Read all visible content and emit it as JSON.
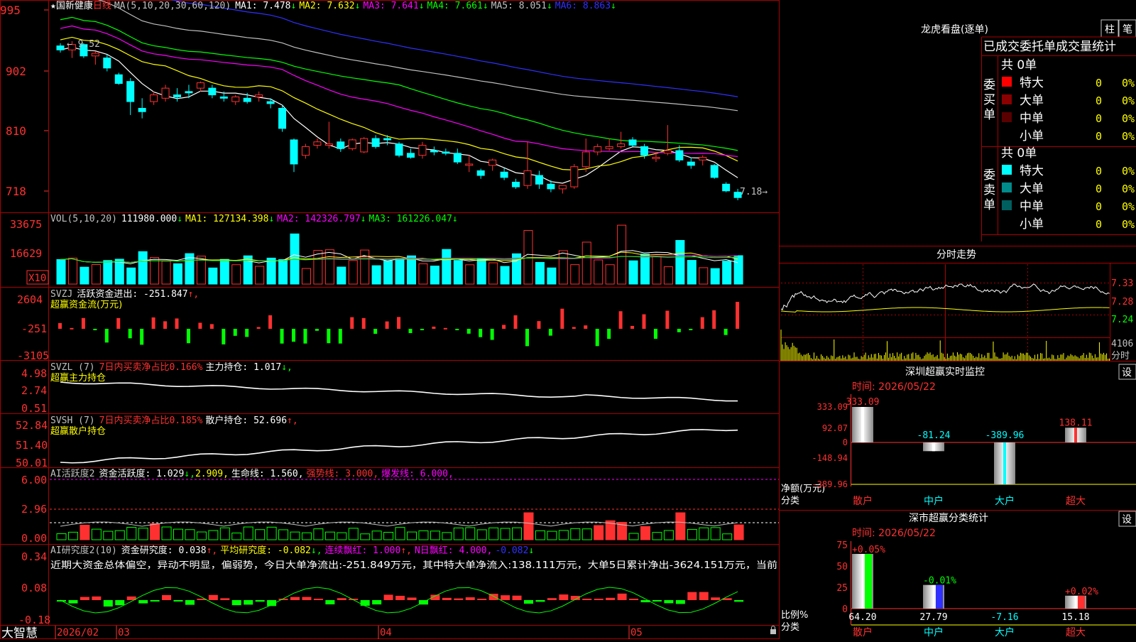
{
  "app": {
    "brand": "大智慧",
    "date_axis": {
      "labels": [
        "2026/02",
        "03",
        "04",
        "05"
      ]
    }
  },
  "colors": {
    "up": "#ff3030",
    "down": "#00ffff",
    "grid": "#aa0000",
    "axis_text": "#ff3030",
    "ma1": "#ffffff",
    "ma2": "#ffff00",
    "ma3": "#ff00ff",
    "ma4": "#00ff00",
    "ma5": "#c0c0c0",
    "ma6": "#3030ff",
    "white_line": "#ffffff",
    "yellow": "#ffff00",
    "magenta": "#ff00ff",
    "green": "#00ff00",
    "cyan": "#00ffff"
  },
  "kline": {
    "stock": "★国新健康",
    "period": "日线",
    "ma_text": "MA(5,10,20,30,60,120)",
    "mas": [
      {
        "label": "MA1: 7.478",
        "arrow": "↓"
      },
      {
        "label": "MA2: 7.632",
        "arrow": "↓"
      },
      {
        "label": "MA3: 7.641",
        "arrow": "↓"
      },
      {
        "label": "MA4: 7.661",
        "arrow": "↓"
      },
      {
        "label": "MA5: 8.051",
        "arrow": "↓"
      },
      {
        "label": "MA6: 8.863",
        "arrow": "↓"
      }
    ],
    "y_ticks": [
      "995",
      "902",
      "810",
      "718"
    ],
    "high_label": "9.52",
    "low_label": "7.18→"
  },
  "volume": {
    "title": "VOL(5,10,20)",
    "value": "111980.000",
    "items": [
      {
        "label": "MA1: 127134.398",
        "arrow": "↓"
      },
      {
        "label": "MA2: 142326.797",
        "arrow": "↓"
      },
      {
        "label": "MA3: 161226.047",
        "arrow": "↓"
      }
    ],
    "y_ticks": [
      "33675",
      "16629"
    ],
    "unit_label": "X10"
  },
  "svzj": {
    "title": "SVZJ",
    "metric": "活跃资金进出: -251.847",
    "arrow": "↑,",
    "subtitle": "超赢资金流(万元)",
    "y_ticks": [
      "2604",
      "-251",
      "-3105"
    ]
  },
  "svzl": {
    "title": "SVZL (7)",
    "ratio": "7日内买卖净占比0.166%",
    "metric": "主力持仓: 1.017",
    "arrow": "↓,",
    "subtitle": "超赢主力持仓",
    "y_ticks": [
      "4.98",
      "2.74",
      "0.51"
    ]
  },
  "svsh": {
    "title": "SVSH (7)",
    "ratio": "7日内买卖净占比0.185%",
    "metric": "散户持仓: 52.696",
    "arrow": "↑,",
    "subtitle": "超赢散户持仓",
    "y_ticks": [
      "52.84",
      "51.40",
      "50.01"
    ]
  },
  "ai_active": {
    "title": "AI活跃度2",
    "metric1": "资金活跃度: 1.029",
    "arrow1": "↓,",
    "metric2": "2.909,",
    "metric3": "生命线: 1.560,",
    "strong": "强势线: 3.000,",
    "burst": "爆发线: 6.000,",
    "y_ticks": [
      "6.00",
      "2.96",
      "0.00"
    ]
  },
  "ai_research": {
    "title": "AI研究度2(10)",
    "metric1": "资金研究度: 0.038",
    "arrow1": "↑,",
    "metric2": "平均研究度: -0.082",
    "arrow2": "↓,",
    "metric3": "连续飘红: 1.000",
    "arrow3": "↑,",
    "metric4": "N日飘红: 4.000,",
    "metric5": "-0.082",
    "arrow5": "↓",
    "summary": "近期大资金总体偏空，异动不明显，偏弱势，今日大单净流出:-251.849万元，其中特大单净流入:138.111万元，大单5日累计净出-3624.151万元，当前",
    "y_ticks": [
      "0.34",
      "0.08",
      "-0.18"
    ]
  },
  "dragon_panel": {
    "title": "龙虎看盘(逐单)",
    "tab_bar": "柱",
    "tab_pen": "笔",
    "stats_title": "已成交委托单成交量统计",
    "buy": {
      "side_label": "委买单",
      "total": "共 0单",
      "rows": [
        {
          "name": "特大",
          "count": "0",
          "pct": "0%",
          "color": "#ff0000"
        },
        {
          "name": "大单",
          "count": "0",
          "pct": "0%",
          "color": "#8b0000"
        },
        {
          "name": "中单",
          "count": "0",
          "pct": "0%",
          "color": "#5a0000"
        },
        {
          "name": "小单",
          "count": "0",
          "pct": "0%",
          "color": ""
        }
      ]
    },
    "sell": {
      "side_label": "委卖单",
      "total": "共 0单",
      "rows": [
        {
          "name": "特大",
          "count": "0",
          "pct": "0%",
          "color": "#00ffff"
        },
        {
          "name": "大单",
          "count": "0",
          "pct": "0%",
          "color": "#008b8b"
        },
        {
          "name": "中单",
          "count": "0",
          "pct": "0%",
          "color": "#006060"
        },
        {
          "name": "小单",
          "count": "0",
          "pct": "0%",
          "color": ""
        }
      ]
    }
  },
  "intraday": {
    "title": "分时走势",
    "price_ticks": [
      "7.33",
      "7.28",
      "7.24"
    ],
    "vol_tick": "4106",
    "vol_label": "分时"
  },
  "monitor": {
    "title": "深圳超赢实时监控",
    "settings": "设",
    "time": "时间: 2026/05/22",
    "y_ticks": [
      "333.09",
      "92.07",
      "0",
      "-148.94",
      "-389.96"
    ],
    "y_label": "净额(万元)",
    "x_label": "分类",
    "categories": [
      "散户",
      "中户",
      "大户",
      "超大"
    ],
    "values": [
      333.09,
      -81.24,
      -389.96,
      138.11
    ],
    "value_labels": [
      "333.09",
      "-81.24",
      "-389.96",
      "138.11"
    ],
    "bar_colors": [
      "#ffffff",
      "#ffffff",
      "#00ffff",
      "#ff3030"
    ]
  },
  "classify": {
    "title": "深市超赢分类统计",
    "settings": "设",
    "time": "时间: 2026/05/22",
    "y_ticks": [
      "75",
      "50",
      "25",
      "0"
    ],
    "y_label": "比例%",
    "x_label": "分类",
    "categories": [
      "散户",
      "中户",
      "大户",
      "超大"
    ],
    "values": [
      64.2,
      27.79,
      -7.16,
      15.18
    ],
    "value_labels": [
      "64.20",
      "27.79",
      "-7.16",
      "15.18"
    ],
    "change_labels": [
      "+0.05%",
      "-0.01%",
      "",
      "+0.02%"
    ],
    "bar_colors": [
      "#00ff00",
      "#3030ff",
      "",
      "#ff3030"
    ]
  },
  "chart_data": {
    "type": "candlestick",
    "title": "★国新健康 日线",
    "x_labels": [
      "2026/02",
      "03",
      "04",
      "05"
    ],
    "ylim": [
      7.0,
      10.1
    ],
    "y_ticks": [
      9.95,
      9.02,
      8.1,
      7.18
    ],
    "annotations": [
      "9.52",
      "7.18"
    ],
    "ohlc": [
      [
        9.48,
        9.52,
        9.38,
        9.42
      ],
      [
        9.42,
        9.55,
        9.3,
        9.5
      ],
      [
        9.5,
        9.52,
        9.3,
        9.33
      ],
      [
        9.33,
        9.4,
        9.2,
        9.37
      ],
      [
        9.3,
        9.35,
        9.1,
        9.15
      ],
      [
        9.05,
        9.08,
        8.9,
        8.92
      ],
      [
        8.95,
        9.0,
        8.45,
        8.65
      ],
      [
        8.55,
        8.7,
        8.4,
        8.5
      ],
      [
        8.65,
        8.8,
        8.6,
        8.75
      ],
      [
        8.7,
        8.9,
        8.65,
        8.85
      ],
      [
        8.75,
        8.85,
        8.65,
        8.72
      ],
      [
        8.8,
        8.9,
        8.7,
        8.78
      ],
      [
        8.85,
        8.95,
        8.8,
        8.93
      ],
      [
        8.85,
        8.9,
        8.7,
        8.75
      ],
      [
        8.72,
        8.8,
        8.65,
        8.7
      ],
      [
        8.65,
        8.75,
        8.6,
        8.72
      ],
      [
        8.7,
        8.78,
        8.62,
        8.65
      ],
      [
        8.72,
        8.8,
        8.65,
        8.75
      ],
      [
        8.65,
        8.7,
        8.55,
        8.62
      ],
      [
        8.55,
        8.6,
        8.2,
        8.25
      ],
      [
        8.08,
        8.1,
        7.6,
        7.72
      ],
      [
        7.85,
        8.02,
        7.8,
        7.98
      ],
      [
        8.0,
        8.1,
        7.95,
        8.05
      ],
      [
        8.0,
        8.35,
        7.95,
        8.02
      ],
      [
        8.05,
        8.1,
        7.9,
        7.95
      ],
      [
        7.95,
        8.1,
        7.92,
        8.08
      ],
      [
        7.9,
        8.12,
        7.88,
        8.1
      ],
      [
        8.1,
        8.15,
        7.95,
        7.98
      ],
      [
        8.1,
        8.15,
        8.0,
        8.08
      ],
      [
        8.02,
        8.05,
        7.82,
        7.85
      ],
      [
        7.88,
        7.95,
        7.8,
        7.82
      ],
      [
        7.85,
        8.05,
        7.8,
        8.0
      ],
      [
        7.92,
        7.98,
        7.85,
        7.9
      ],
      [
        7.9,
        7.95,
        7.85,
        7.88
      ],
      [
        7.88,
        7.95,
        7.72,
        7.75
      ],
      [
        7.7,
        7.85,
        7.6,
        7.72
      ],
      [
        7.62,
        7.65,
        7.5,
        7.55
      ],
      [
        7.7,
        7.8,
        7.62,
        7.78
      ],
      [
        7.6,
        7.66,
        7.48,
        7.52
      ],
      [
        7.45,
        7.5,
        7.35,
        7.38
      ],
      [
        7.4,
        8.05,
        7.35,
        7.62
      ],
      [
        7.55,
        7.62,
        7.35,
        7.42
      ],
      [
        7.42,
        7.48,
        7.3,
        7.35
      ],
      [
        7.35,
        7.4,
        7.28,
        7.4
      ],
      [
        7.38,
        7.72,
        7.35,
        7.68
      ],
      [
        7.68,
        8.1,
        7.6,
        7.9
      ],
      [
        7.9,
        8.02,
        7.85,
        7.98
      ],
      [
        7.95,
        8.1,
        7.92,
        7.98
      ],
      [
        7.98,
        8.2,
        7.95,
        8.02
      ],
      [
        8.08,
        8.12,
        7.98,
        8.0
      ],
      [
        7.98,
        8.02,
        7.8,
        7.85
      ],
      [
        7.8,
        7.9,
        7.75,
        7.82
      ],
      [
        7.88,
        8.3,
        7.85,
        7.92
      ],
      [
        7.92,
        8.0,
        7.75,
        7.78
      ],
      [
        7.75,
        7.82,
        7.65,
        7.7
      ],
      [
        7.78,
        7.85,
        7.7,
        7.82
      ],
      [
        7.7,
        7.72,
        7.5,
        7.52
      ],
      [
        7.42,
        7.45,
        7.3,
        7.32
      ],
      [
        7.3,
        7.35,
        7.18,
        7.22
      ]
    ]
  }
}
